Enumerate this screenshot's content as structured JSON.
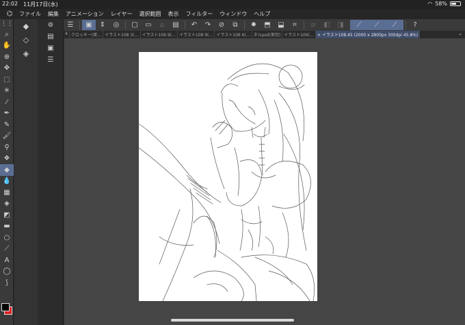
{
  "status_bar": {
    "time": "22:02",
    "date": "11月17日(水)",
    "battery": "58%",
    "battery_level": 0.58
  },
  "menu": {
    "items": [
      "ファイル",
      "編集",
      "アニメーション",
      "レイヤー",
      "選択範囲",
      "表示",
      "フィルター",
      "ウィンドウ",
      "ヘルプ"
    ]
  },
  "tabs": {
    "items": [
      "4",
      "クロッキー(実…",
      "イラスト108 3(…",
      "イラスト106 9(…",
      "イラスト108 9(…",
      "イラスト106 6(…",
      "ネルpsd(実完)",
      "イラスト106(…",
      "× イラスト108.45 (2000 x 2800px 300dpi 45.8%)"
    ],
    "active_index": 8
  },
  "colors": {
    "main": "#000000",
    "sub": "#e02020",
    "accent": "#5a6e94"
  }
}
